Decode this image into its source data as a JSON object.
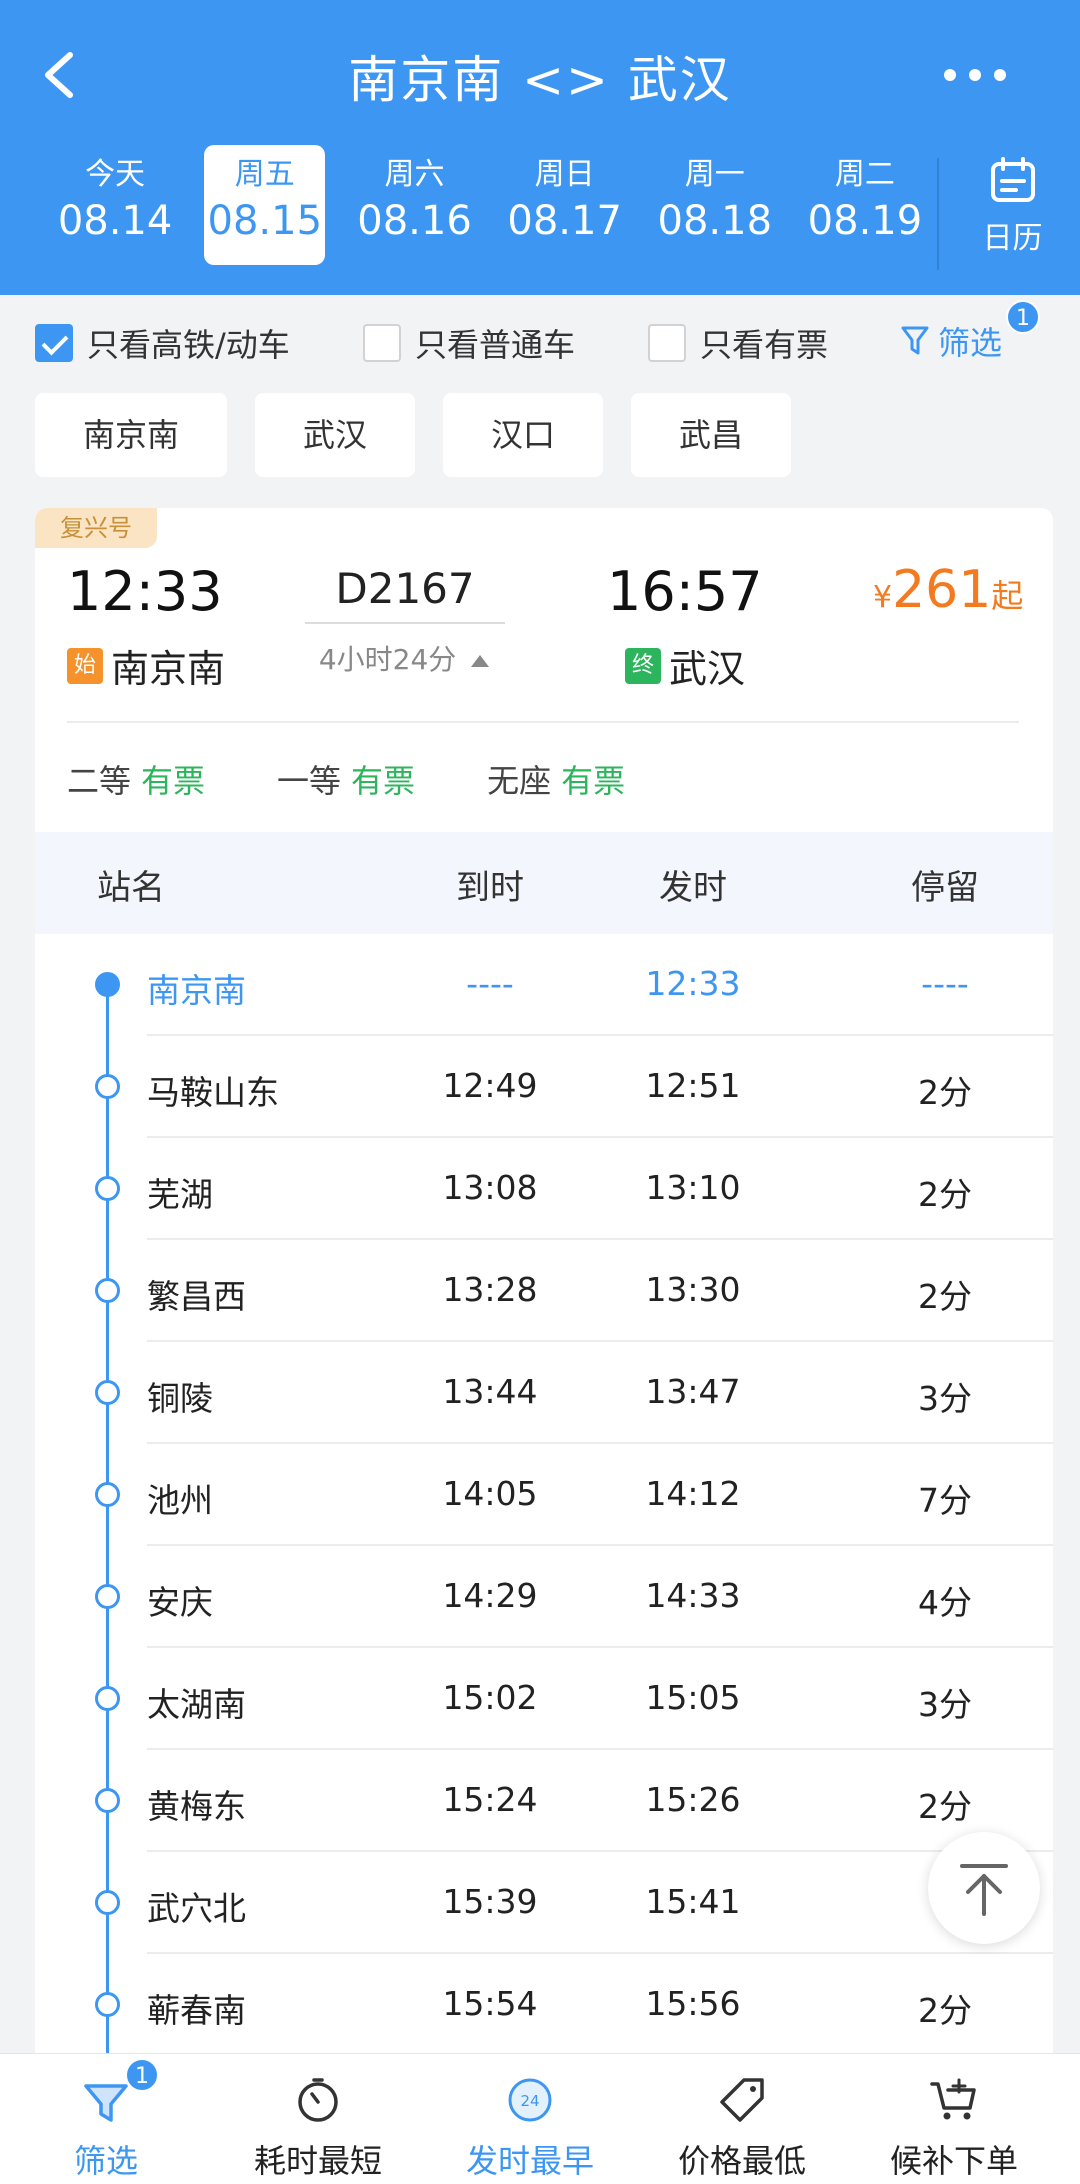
{
  "header": {
    "title": "南京南 <> 武汉",
    "dates": [
      {
        "weekday": "今天",
        "date": "08.14"
      },
      {
        "weekday": "周五",
        "date": "08.15"
      },
      {
        "weekday": "周六",
        "date": "08.16"
      },
      {
        "weekday": "周日",
        "date": "08.17"
      },
      {
        "weekday": "周一",
        "date": "08.18"
      },
      {
        "weekday": "周二",
        "date": "08.19"
      }
    ],
    "calendar_label": "日历"
  },
  "filters": {
    "high_speed": {
      "label": "只看高铁/动车",
      "checked": true
    },
    "normal": {
      "label": "只看普通车",
      "checked": false
    },
    "available": {
      "label": "只看有票",
      "checked": false
    },
    "screen_label": "筛选",
    "screen_badge": "1"
  },
  "station_chips": [
    "南京南",
    "武汉",
    "汉口",
    "武昌"
  ],
  "train": {
    "tag": "复兴号",
    "dep_time": "12:33",
    "arr_time": "16:57",
    "number": "D2167",
    "duration": "4小时24分",
    "start_mark": "始",
    "end_mark": "终",
    "from": "南京南",
    "to": "武汉",
    "price_currency": "¥",
    "price_value": "261",
    "price_suffix": "起",
    "seats": [
      {
        "class": "二等",
        "status": "有票"
      },
      {
        "class": "一等",
        "status": "有票"
      },
      {
        "class": "无座",
        "status": "有票"
      }
    ]
  },
  "stop_table": {
    "headers": {
      "name": "站名",
      "arrive": "到时",
      "depart": "发时",
      "stay": "停留"
    },
    "stops": [
      {
        "name": "南京南",
        "arrive": "----",
        "depart": "12:33",
        "stay": "----"
      },
      {
        "name": "马鞍山东",
        "arrive": "12:49",
        "depart": "12:51",
        "stay": "2分"
      },
      {
        "name": "芜湖",
        "arrive": "13:08",
        "depart": "13:10",
        "stay": "2分"
      },
      {
        "name": "繁昌西",
        "arrive": "13:28",
        "depart": "13:30",
        "stay": "2分"
      },
      {
        "name": "铜陵",
        "arrive": "13:44",
        "depart": "13:47",
        "stay": "3分"
      },
      {
        "name": "池州",
        "arrive": "14:05",
        "depart": "14:12",
        "stay": "7分"
      },
      {
        "name": "安庆",
        "arrive": "14:29",
        "depart": "14:33",
        "stay": "4分"
      },
      {
        "name": "太湖南",
        "arrive": "15:02",
        "depart": "15:05",
        "stay": "3分"
      },
      {
        "name": "黄梅东",
        "arrive": "15:24",
        "depart": "15:26",
        "stay": "2分"
      },
      {
        "name": "武穴北",
        "arrive": "15:39",
        "depart": "15:41",
        "stay": ""
      },
      {
        "name": "蕲春南",
        "arrive": "15:54",
        "depart": "15:56",
        "stay": "2分"
      }
    ]
  },
  "bottom_bar": {
    "items": [
      {
        "label": "筛选",
        "icon": "filter-icon",
        "badge": "1"
      },
      {
        "label": "耗时最短",
        "icon": "stopwatch-icon"
      },
      {
        "label": "发时最早",
        "icon": "24h-icon"
      },
      {
        "label": "价格最低",
        "icon": "price-tag-icon"
      },
      {
        "label": "候补下单",
        "icon": "cart-icon"
      }
    ]
  },
  "colors": {
    "primary": "#3d97f2",
    "price": "#f47a20",
    "available": "#2db55d"
  }
}
